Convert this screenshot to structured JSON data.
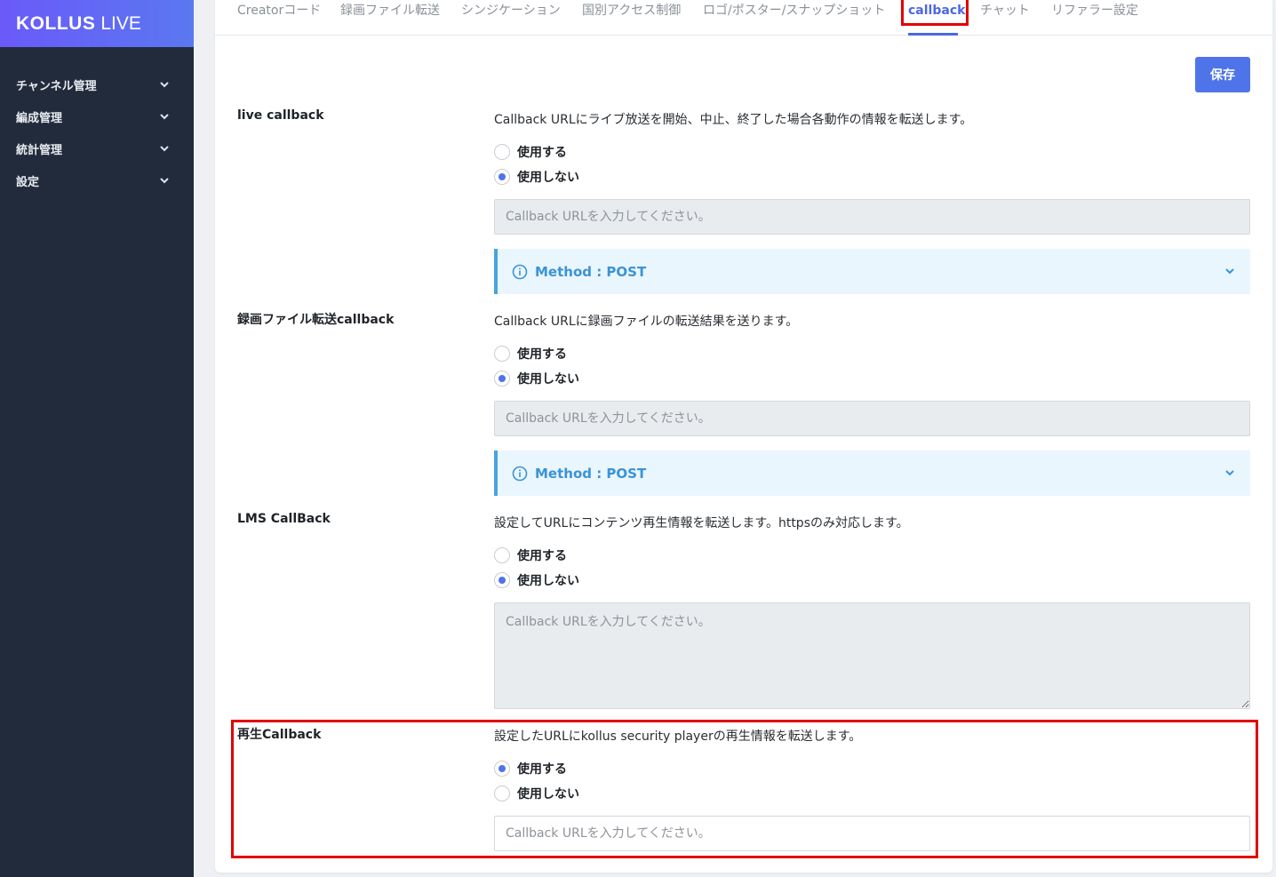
{
  "brand": {
    "bold": "KOLLUS",
    "thin": "LIVE"
  },
  "sidebar": {
    "items": [
      {
        "label": "チャンネル管理"
      },
      {
        "label": "編成管理"
      },
      {
        "label": "統計管理"
      },
      {
        "label": "設定"
      }
    ]
  },
  "tabs": [
    {
      "label": "Creatorコード"
    },
    {
      "label": "録画ファイル転送"
    },
    {
      "label": "シンジケーション"
    },
    {
      "label": "国別アクセス制御"
    },
    {
      "label": "ロゴ/ポスター/スナップショット"
    },
    {
      "label": "callback",
      "active": true
    },
    {
      "label": "チャット"
    },
    {
      "label": "リファラー設定"
    }
  ],
  "save_label": "保存",
  "radio_on_label": "使用する",
  "radio_off_label": "使用しない",
  "url_placeholder": "Callback URLを入力してください。",
  "method_text": "Method : POST",
  "sections": [
    {
      "label": "live callback",
      "description": "Callback URLにライブ放送を開始、中止、終了した場合各動作の情報を転送します。",
      "enabled": false
    },
    {
      "label": "録画ファイル転送callback",
      "description": "Callback URLに録画ファイルの転送結果を送ります。",
      "enabled": false
    },
    {
      "label": "LMS CallBack",
      "description": "設定してURLにコンテンツ再生情報を転送します。httpsのみ対応します。",
      "enabled": false
    },
    {
      "label": "再生Callback",
      "description": "設定したURLにkollus security playerの再生情報を転送します。",
      "enabled": true
    }
  ],
  "colors": {
    "accent": "#4f74e9",
    "sidebar_bg": "#222b3b",
    "highlight": "#e10000",
    "info": "#3a93d6"
  }
}
